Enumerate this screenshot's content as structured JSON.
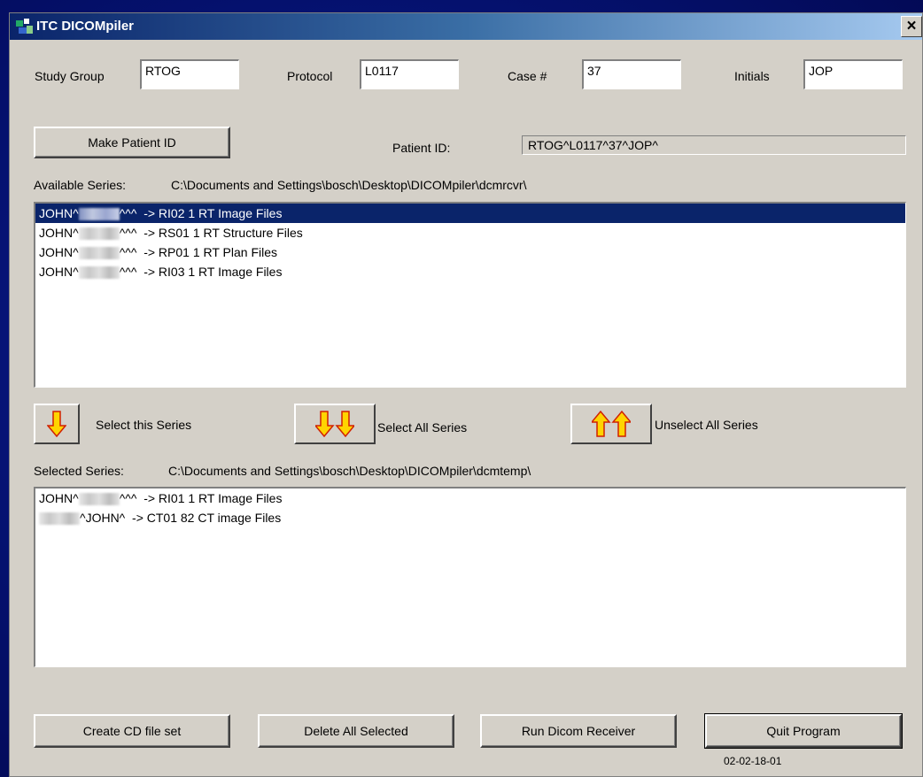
{
  "window": {
    "title": "ITC DICOMpiler",
    "close_label": "×"
  },
  "header_fields": {
    "study_group": {
      "label": "Study Group",
      "value": "RTOG"
    },
    "protocol": {
      "label": "Protocol",
      "value": "L0117"
    },
    "case": {
      "label": "Case #",
      "value": "37"
    },
    "initials": {
      "label": "Initials",
      "value": "JOP"
    }
  },
  "patient": {
    "make_button": "Make Patient ID",
    "id_label": "Patient ID:",
    "id_value": "RTOG^L0117^37^JOP^"
  },
  "available": {
    "label": "Available Series:",
    "path": "C:\\Documents and Settings\\bosch\\Desktop\\DICOMpiler\\dcmrcvr\\",
    "rows": [
      {
        "prefix": "JOHN^",
        "suffix": "^^^",
        "desc": "-> RI02  1 RT Image Files",
        "selected": true
      },
      {
        "prefix": "JOHN^",
        "suffix": "^^^",
        "desc": "-> RS01  1 RT Structure Files",
        "selected": false
      },
      {
        "prefix": "JOHN^",
        "suffix": "^^^",
        "desc": "-> RP01  1 RT Plan Files",
        "selected": false
      },
      {
        "prefix": "JOHN^",
        "suffix": "^^^",
        "desc": "-> RI03  1 RT Image Files",
        "selected": false
      }
    ]
  },
  "actions": {
    "select_one": "Select this Series",
    "select_all": "Select All Series",
    "unselect_all": "Unselect All Series"
  },
  "selected": {
    "label": "Selected Series:",
    "path": "C:\\Documents and Settings\\bosch\\Desktop\\DICOMpiler\\dcmtemp\\",
    "rows": [
      {
        "prefix": "JOHN^",
        "suffix": "^^^",
        "desc": "-> RI01  1 RT Image Files"
      },
      {
        "prefix": "",
        "suffix": "^JOHN^",
        "desc": "-> CT01  82 CT image Files"
      }
    ]
  },
  "footer": {
    "create_cd": "Create CD file set",
    "delete_all": "Delete All Selected",
    "run_receiver": "Run Dicom Receiver",
    "quit": "Quit Program",
    "version": "02-02-18-01"
  },
  "colors": {
    "selection": "#0a246a",
    "window_bg": "#d4d0c8",
    "arrow_fill": "#ffd400",
    "arrow_stroke": "#d02000"
  }
}
